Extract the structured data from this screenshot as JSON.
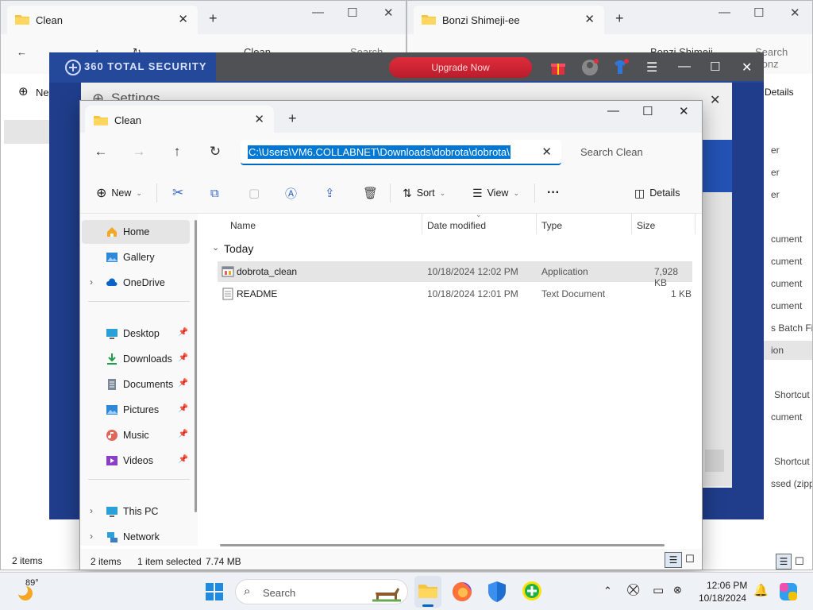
{
  "background_windows": {
    "left": {
      "tab_title": "Clean",
      "breadcrumb": "Clean",
      "search_placeholder": "Search Clea",
      "new_label": "Ne",
      "status": "2 items"
    },
    "right": {
      "tab_title": "Bonzi Shimeji-ee",
      "breadcrumb": "Bonzi Shimeji",
      "search_placeholder": "Search Bonz",
      "details_label": "Details"
    }
  },
  "security_app": {
    "title": "360 TOTAL SECURITY",
    "upgrade_label": "Upgrade Now",
    "settings_title": "Settings"
  },
  "right_column_types": [
    "er",
    "er",
    "er",
    "cument",
    "cument",
    "cument",
    "cument",
    "s Batch File",
    "ion",
    "Shortcut",
    "cument",
    "Shortcut",
    "ssed (zipped"
  ],
  "explorer": {
    "tab_title": "Clean",
    "address_value": "C:\\Users\\VM6.COLLABNET\\Downloads\\dobrota\\dobrota\\",
    "search_placeholder": "Search Clean",
    "commands": {
      "new": "New",
      "sort": "Sort",
      "view": "View",
      "details": "Details",
      "more": "···"
    },
    "sidebar": {
      "home": "Home",
      "gallery": "Gallery",
      "onedrive": "OneDrive",
      "desktop": "Desktop",
      "downloads": "Downloads",
      "documents": "Documents",
      "pictures": "Pictures",
      "music": "Music",
      "videos": "Videos",
      "thispc": "This PC",
      "network": "Network"
    },
    "columns": {
      "name": "Name",
      "date": "Date modified",
      "type": "Type",
      "size": "Size"
    },
    "group": "Today",
    "files": [
      {
        "name": "dobrota_clean",
        "date": "10/18/2024 12:02 PM",
        "type": "Application",
        "size": "7,928 KB"
      },
      {
        "name": "README",
        "date": "10/18/2024 12:01 PM",
        "type": "Text Document",
        "size": "1 KB"
      }
    ],
    "status": {
      "items": "2 items",
      "selected": "1 item selected",
      "size": "7.74 MB"
    }
  },
  "taskbar": {
    "weather": "89°",
    "search_placeholder": "Search",
    "time": "12:06 PM",
    "date": "10/18/2024"
  }
}
